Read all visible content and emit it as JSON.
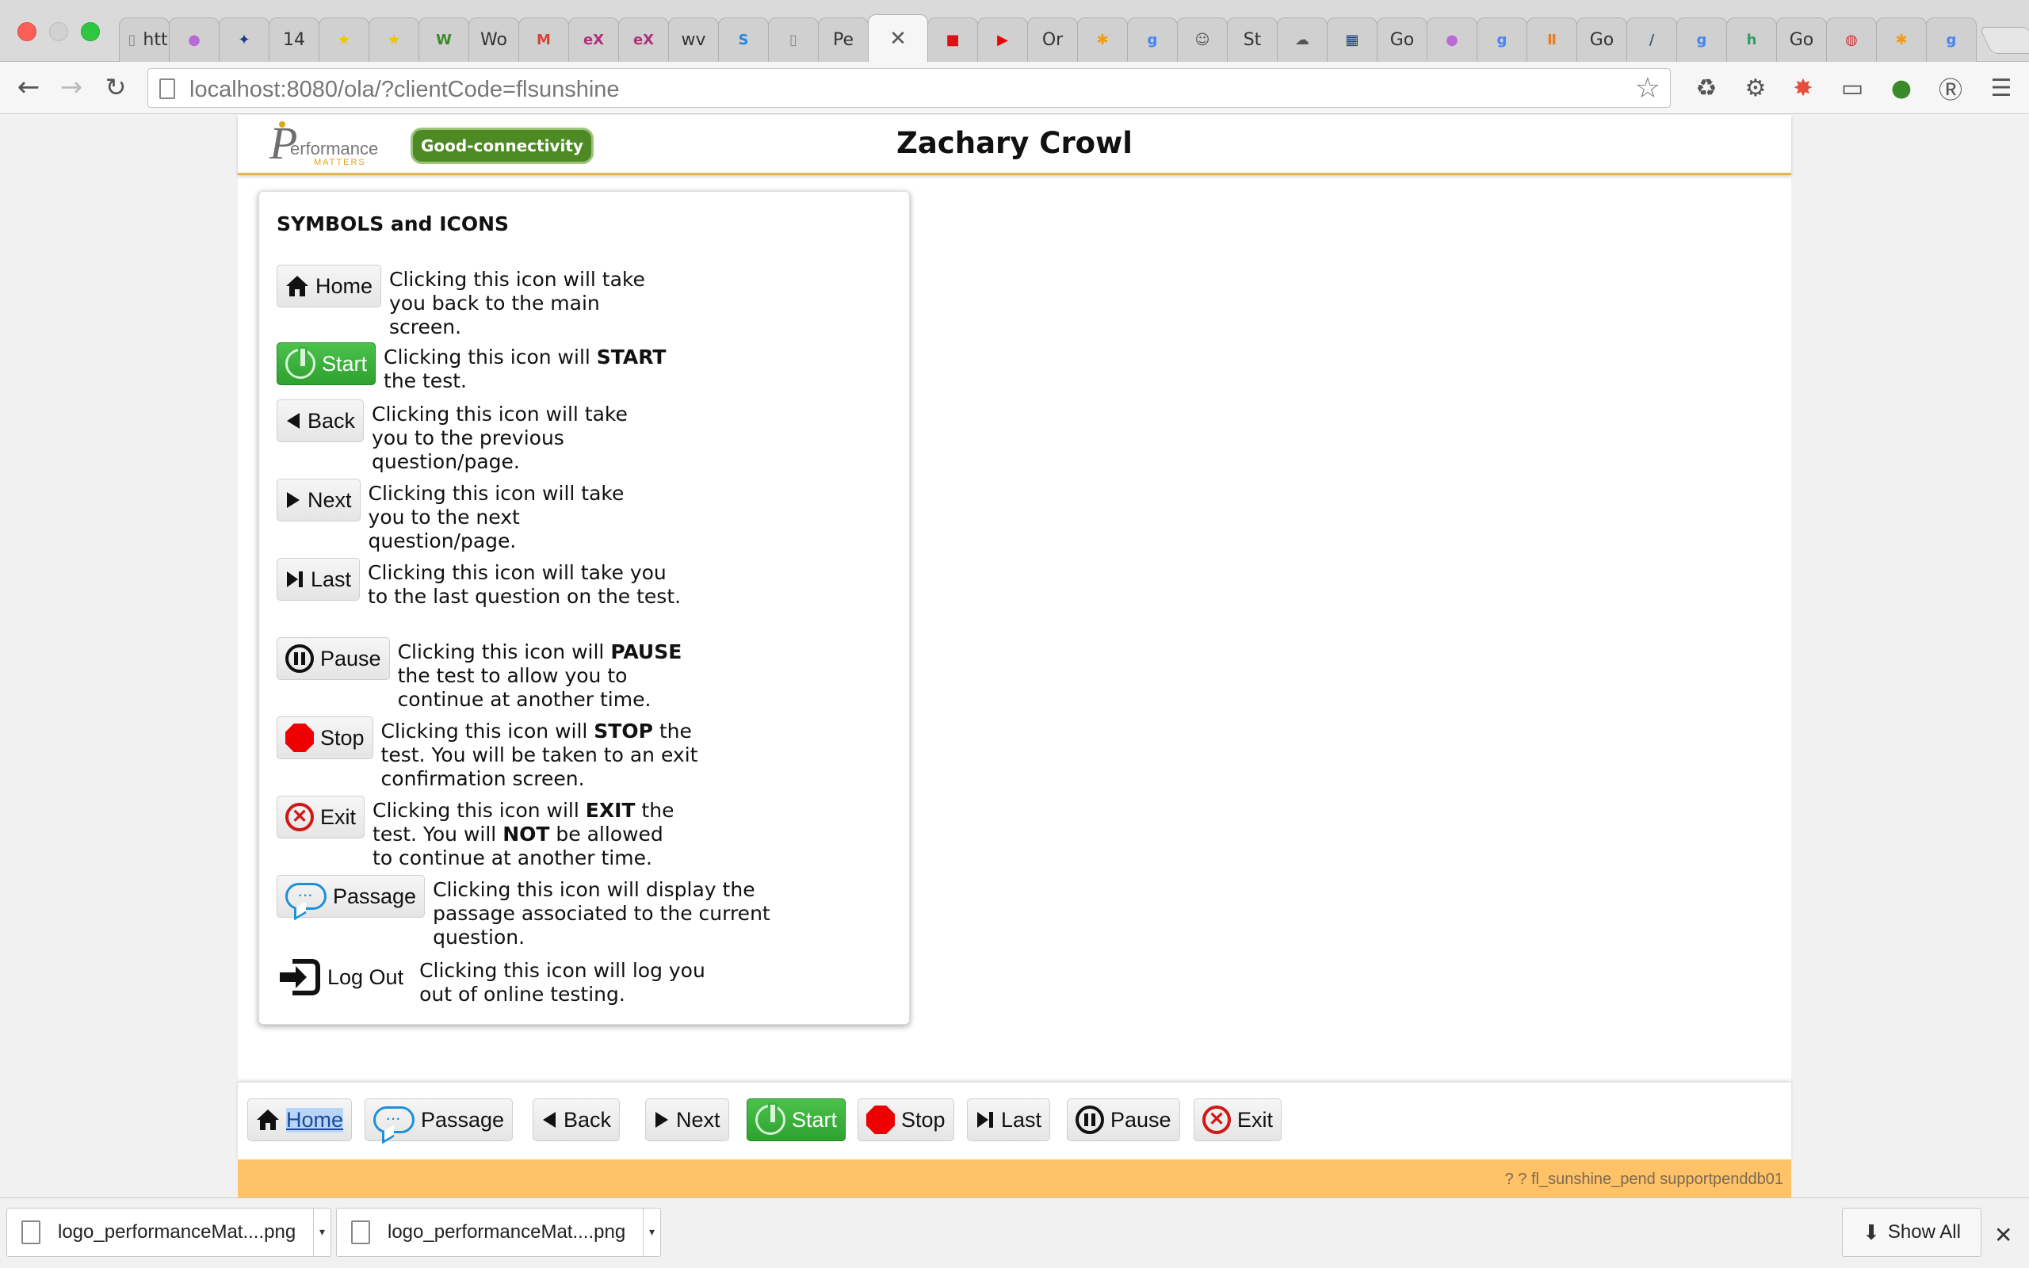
{
  "browser": {
    "tabs": [
      {
        "label": "htt",
        "icon": "page-icon"
      },
      {
        "label": "",
        "icon": "circles-icon",
        "color": "#b96ad8"
      },
      {
        "label": "",
        "icon": "figure-icon",
        "color": "#1a3b8a"
      },
      {
        "label": "14",
        "icon": "",
        "color": ""
      },
      {
        "label": "",
        "icon": "star-icon",
        "color": "#f3c200"
      },
      {
        "label": "",
        "icon": "star-icon",
        "color": "#f3c200"
      },
      {
        "label": "",
        "icon": "w-circle-icon",
        "color": "#3b8a2a"
      },
      {
        "label": "Wo",
        "icon": "",
        "color": ""
      },
      {
        "label": "",
        "icon": "gmail-icon",
        "color": "#d44638"
      },
      {
        "label": "",
        "icon": "edx-icon",
        "color": "#b0307a"
      },
      {
        "label": "",
        "icon": "edx-icon",
        "color": "#b0307a"
      },
      {
        "label": "wv",
        "icon": "",
        "color": ""
      },
      {
        "label": "",
        "icon": "s-icon",
        "color": "#1e88e5"
      },
      {
        "label": "",
        "icon": "page-icon",
        "color": ""
      },
      {
        "label": "Pe",
        "icon": "",
        "color": ""
      },
      {
        "label": "",
        "icon": "close-icon",
        "color": "",
        "active": true
      },
      {
        "label": "",
        "icon": "red-square-icon",
        "color": "#d11"
      },
      {
        "label": "",
        "icon": "youtube-icon",
        "color": "#e00"
      },
      {
        "label": "Or",
        "icon": "",
        "color": ""
      },
      {
        "label": "",
        "icon": "asterisk-icon",
        "color": "#f39c12"
      },
      {
        "label": "",
        "icon": "g-icon",
        "color": "#4285f4"
      },
      {
        "label": "",
        "icon": "person-icon",
        "color": "#555"
      },
      {
        "label": "St",
        "icon": "",
        "color": ""
      },
      {
        "label": "",
        "icon": "cloud-icon",
        "color": "#555"
      },
      {
        "label": "",
        "icon": "grid-icon",
        "color": "#1a3b8a"
      },
      {
        "label": "Go",
        "icon": "",
        "color": ""
      },
      {
        "label": "",
        "icon": "circles-icon",
        "color": "#b96ad8"
      },
      {
        "label": "",
        "icon": "g-icon",
        "color": "#4285f4"
      },
      {
        "label": "",
        "icon": "bars-icon",
        "color": "#e67e22"
      },
      {
        "label": "Go",
        "icon": "",
        "color": ""
      },
      {
        "label": "",
        "icon": "slash-icon",
        "color": "#3e5f7a"
      },
      {
        "label": "",
        "icon": "g-icon",
        "color": "#4285f4"
      },
      {
        "label": "",
        "icon": "h-icon",
        "color": "#2e9d6a"
      },
      {
        "label": "Go",
        "icon": "",
        "color": ""
      },
      {
        "label": "",
        "icon": "color-wheel-icon",
        "color": "#c33"
      },
      {
        "label": "",
        "icon": "asterisk-icon",
        "color": "#f39c12"
      },
      {
        "label": "",
        "icon": "g-icon",
        "color": "#4285f4"
      }
    ],
    "url_host": "localhost",
    "url_rest": ":8080/ola/?clientCode=flsunshine"
  },
  "header": {
    "logo_letter": "P",
    "logo_word": "erformance",
    "logo_sub": "MATTERS",
    "connectivity": "Good-connectivity",
    "student_name": "Zachary Crowl"
  },
  "symbols": {
    "title": "SYMBOLS and ICONS",
    "rows": [
      {
        "button": "Home",
        "icon": "home-icon",
        "desc_html": "Clicking this icon will take you back to the main screen."
      },
      {
        "button": "Start",
        "icon": "power-icon",
        "desc_html": "Clicking this icon will <b>START</b> the test."
      },
      {
        "button": "Back",
        "icon": "back-arrow-icon",
        "desc_html": "Clicking this icon will take you to the previous question/page."
      },
      {
        "button": "Next",
        "icon": "next-arrow-icon",
        "desc_html": "Clicking this icon will take you to the next question/page."
      },
      {
        "button": "Last",
        "icon": "last-icon",
        "desc_html": "Clicking this icon will take you to the last question on the test."
      },
      {
        "button": "Pause",
        "icon": "pause-icon",
        "desc_html": "Clicking this icon will <b>PAUSE</b> the test to allow you to continue at another time."
      },
      {
        "button": "Stop",
        "icon": "stop-icon",
        "desc_html": "Clicking this icon will <b>STOP</b> the test. You will be taken to an exit confirmation screen."
      },
      {
        "button": "Exit",
        "icon": "exit-icon",
        "desc_html": "Clicking this icon will <b>EXIT</b> the test. You will <b>NOT</b> be allowed to continue at another time."
      },
      {
        "button": "Passage",
        "icon": "speech-bubble-icon",
        "desc_html": "Clicking this icon will display the passage associated to the current question."
      },
      {
        "button": "Log Out",
        "icon": "logout-icon",
        "desc_html": "Clicking this icon will log you out of online testing."
      }
    ]
  },
  "footer_nav": {
    "home": "Home",
    "passage": "Passage",
    "back": "Back",
    "next": "Next",
    "start": "Start",
    "stop": "Stop",
    "last": "Last",
    "pause": "Pause",
    "exit": "Exit"
  },
  "status_bar": {
    "text": "? ? fl_sunshine_pend supportpenddb01"
  },
  "downloads": {
    "items": [
      {
        "name": "logo_performanceMat....png"
      },
      {
        "name": "logo_performanceMat....png"
      }
    ],
    "show_all": "Show All"
  },
  "colors": {
    "accent_green": "#2ea12e",
    "header_rule": "#e2b74b",
    "status_bar": "#ffc266",
    "stop_red": "#ee0000",
    "passage_blue": "#1e90d8"
  }
}
